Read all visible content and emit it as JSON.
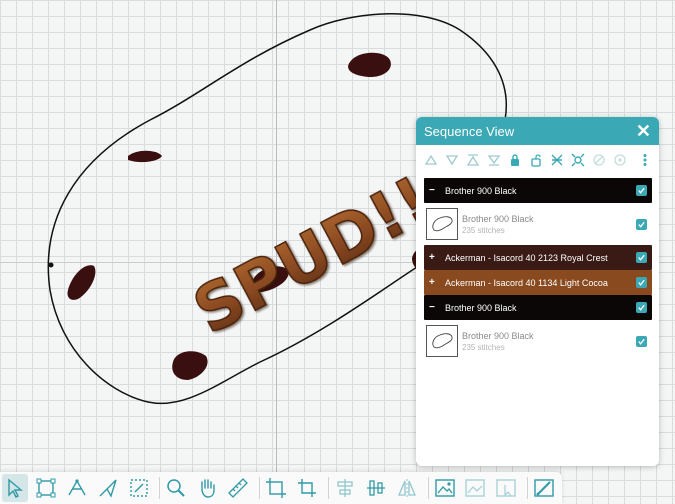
{
  "colors": {
    "accent": "#3aa9b5",
    "brother_black": "#0b0706",
    "royal_crest": "#3a1a15",
    "light_cocoa": "#8a4a1f",
    "embroidery_text": "#8b4a22",
    "dark_spots": "#3a0f10"
  },
  "canvas": {
    "design_text": "SPUD!!"
  },
  "sequence_panel": {
    "title": "Sequence View",
    "toolbar_icons": [
      "move-first-icon",
      "move-up-icon",
      "move-down-icon",
      "move-last-icon",
      "lock-icon",
      "unlock-icon",
      "group-icon",
      "ungroup-icon",
      "visibility-icon",
      "hide-icon",
      "hide-all-icon",
      "more-options-icon"
    ],
    "rows": [
      {
        "type": "group",
        "symbol": "−",
        "label": "Brother 900 Black",
        "color": "#0b0706",
        "checked": true
      },
      {
        "type": "object",
        "name": "Brother 900 Black",
        "stitches": "235 stitches",
        "checked": true
      },
      {
        "type": "group",
        "symbol": "+",
        "label": "Ackerman - Isacord 40 2123 Royal Crest",
        "color": "#3a1a15",
        "checked": true
      },
      {
        "type": "group",
        "symbol": "+",
        "label": "Ackerman - Isacord 40 1134 Light Cocoa",
        "color": "#8a4a1f",
        "checked": true
      },
      {
        "type": "group",
        "symbol": "−",
        "label": "Brother 900 Black",
        "color": "#0b0706",
        "checked": true
      },
      {
        "type": "object",
        "name": "Brother 900 Black",
        "stitches": "235 stitches",
        "checked": true
      }
    ]
  },
  "bottom_toolbar": {
    "icons": [
      "select-tool-icon",
      "node-edit-icon",
      "pen-tool-icon",
      "pen-alt-tool-icon",
      "crop-tool-icon",
      "zoom-icon",
      "pan-hand-icon",
      "ruler-icon",
      "artboard-icon",
      "crop-marks-icon",
      "align-center-icon",
      "align-middle-icon",
      "mirror-icon",
      "image-icon",
      "image-trace-icon",
      "image-edit-icon",
      "design-settings-icon"
    ]
  }
}
